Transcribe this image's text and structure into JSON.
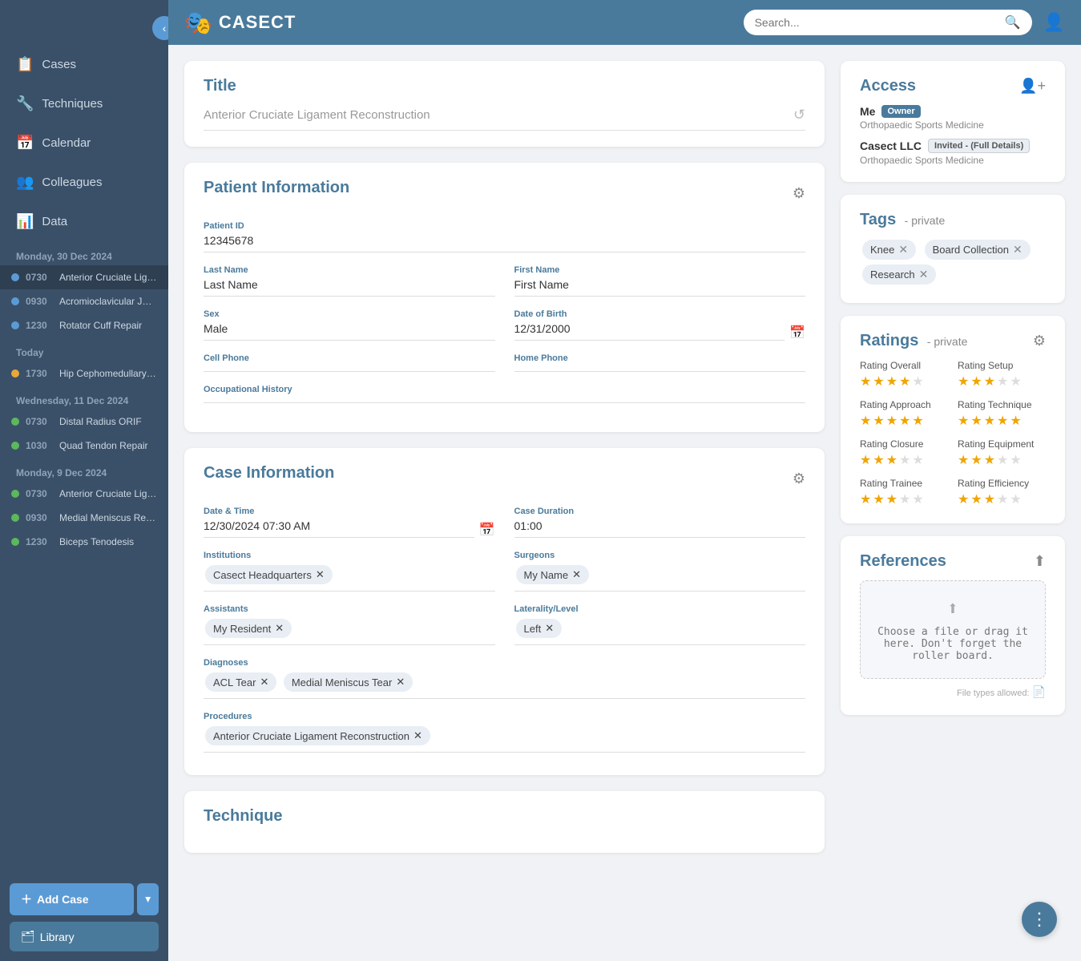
{
  "app": {
    "name": "CASECT",
    "logo": "🎭",
    "search_placeholder": "Search..."
  },
  "sidebar": {
    "nav_items": [
      {
        "id": "cases",
        "label": "Cases",
        "icon": "📋"
      },
      {
        "id": "techniques",
        "label": "Techniques",
        "icon": "🔧"
      },
      {
        "id": "calendar",
        "label": "Calendar",
        "icon": "📅"
      },
      {
        "id": "colleagues",
        "label": "Colleagues",
        "icon": "👥"
      },
      {
        "id": "data",
        "label": "Data",
        "icon": "📊"
      }
    ],
    "sections": [
      {
        "title": "Monday, 30 Dec 2024",
        "cases": [
          {
            "time": "0730",
            "name": "Anterior Cruciate Ligame...",
            "dot": "blue",
            "active": true
          },
          {
            "time": "0930",
            "name": "Acromioclavicular Joint R...",
            "dot": "blue"
          },
          {
            "time": "1230",
            "name": "Rotator Cuff Repair",
            "dot": "blue"
          }
        ]
      },
      {
        "title": "Today",
        "cases": [
          {
            "time": "1730",
            "name": "Hip Cephomedullary Nail",
            "dot": "orange"
          }
        ]
      },
      {
        "title": "Wednesday, 11 Dec 2024",
        "cases": [
          {
            "time": "0730",
            "name": "Distal Radius ORIF",
            "dot": "green"
          },
          {
            "time": "1030",
            "name": "Quad Tendon Repair",
            "dot": "green"
          }
        ]
      },
      {
        "title": "Monday, 9 Dec 2024",
        "cases": [
          {
            "time": "0730",
            "name": "Anterior Cruciate Ligame...",
            "dot": "green"
          },
          {
            "time": "0930",
            "name": "Medial Meniscus Repair",
            "dot": "green"
          },
          {
            "time": "1230",
            "name": "Biceps Tenodesis",
            "dot": "green"
          }
        ]
      }
    ],
    "add_case_label": "Add Case",
    "library_label": "Library"
  },
  "title_section": {
    "label": "Title",
    "value": "Anterior Cruciate Ligament Reconstruction"
  },
  "patient_info": {
    "section_label": "Patient Information",
    "patient_id_label": "Patient ID",
    "patient_id": "12345678",
    "last_name_label": "Last Name",
    "last_name": "Last Name",
    "first_name_label": "First Name",
    "first_name": "First Name",
    "sex_label": "Sex",
    "sex": "Male",
    "dob_label": "Date of Birth",
    "dob": "12/31/2000",
    "cell_phone_label": "Cell Phone",
    "cell_phone": "",
    "home_phone_label": "Home Phone",
    "home_phone": "",
    "occupational_history_label": "Occupational History",
    "occupational_history": ""
  },
  "case_info": {
    "section_label": "Case Information",
    "date_time_label": "Date & Time",
    "date_time": "12/30/2024 07:30 AM",
    "duration_label": "Case Duration",
    "duration": "01:00",
    "institutions_label": "Institutions",
    "institutions": [
      "Casect Headquarters"
    ],
    "surgeons_label": "Surgeons",
    "surgeons": [
      "My Name"
    ],
    "assistants_label": "Assistants",
    "assistants": [
      "My Resident"
    ],
    "laterality_label": "Laterality/Level",
    "laterality": [
      "Left"
    ],
    "diagnoses_label": "Diagnoses",
    "diagnoses": [
      "ACL Tear",
      "Medial Meniscus Tear"
    ],
    "procedures_label": "Procedures",
    "procedures": [
      "Anterior Cruciate Ligament Reconstruction"
    ]
  },
  "technique": {
    "section_label": "Technique"
  },
  "access": {
    "section_label": "Access",
    "add_icon": "➕👤",
    "entries": [
      {
        "name": "Me",
        "badge": "Owner",
        "badge_type": "owner",
        "org": "Orthopaedic Sports Medicine"
      },
      {
        "name": "Casect LLC",
        "badge": "Invited - (Full Details)",
        "badge_type": "invited",
        "org": "Orthopaedic Sports Medicine"
      }
    ]
  },
  "tags": {
    "section_label": "Tags",
    "modifier": "- private",
    "items": [
      "Knee",
      "Board Collection",
      "Research"
    ]
  },
  "ratings": {
    "section_label": "Ratings",
    "modifier": "- private",
    "items": [
      {
        "label": "Rating Overall",
        "filled": 4,
        "empty": 1
      },
      {
        "label": "Rating Setup",
        "filled": 3,
        "empty": 2
      },
      {
        "label": "Rating Approach",
        "filled": 5,
        "empty": 0
      },
      {
        "label": "Rating Technique",
        "filled": 5,
        "empty": 0
      },
      {
        "label": "Rating Closure",
        "filled": 3,
        "empty": 2
      },
      {
        "label": "Rating Equipment",
        "filled": 3,
        "empty": 2
      },
      {
        "label": "Rating Trainee",
        "filled": 3,
        "empty": 2
      },
      {
        "label": "Rating Efficiency",
        "filled": 3,
        "empty": 2
      }
    ]
  },
  "references": {
    "section_label": "References",
    "upload_text": "Choose a file or drag it\nhere. Don't forget the\nroller board.",
    "file_types_label": "File types allowed:"
  }
}
